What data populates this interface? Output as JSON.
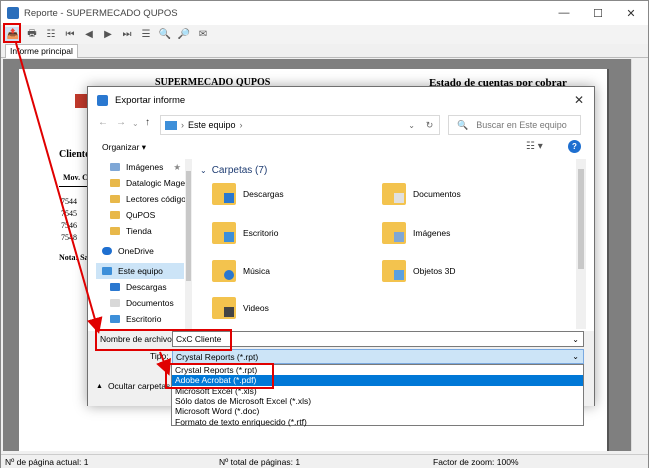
{
  "window": {
    "title": "Reporte - SUPERMECADO QUPOS",
    "tab": "Informe principal"
  },
  "report": {
    "company": "SUPERMECADO QUPOS",
    "heading": "Estado de cuentas por cobrar",
    "client_label": "Cliente",
    "mov_label": "Mov. C",
    "rows": [
      "7544",
      "7545",
      "7546",
      "7548"
    ],
    "note": "Nota: Sal"
  },
  "status": {
    "current_page": "Nº de página actual: 1",
    "total_pages": "Nº total de páginas: 1",
    "zoom": "Factor de zoom: 100%"
  },
  "dialog": {
    "title": "Exportar informe",
    "path": "Este equipo",
    "search_placeholder": "Buscar en Este equipo",
    "organize": "Organizar",
    "nav_items": [
      "Imágenes",
      "Datalogic Magel",
      "Lectores código",
      "QuPOS",
      "Tienda",
      "OneDrive",
      "Este equipo",
      "Descargas",
      "Documentos",
      "Escritorio"
    ],
    "section": "Carpetas (7)",
    "folders": [
      "Descargas",
      "Documentos",
      "Escritorio",
      "Imágenes",
      "Música",
      "Objetos 3D",
      "Videos"
    ],
    "filename_label": "Nombre de archivo:",
    "filename_value": "CxC Cliente",
    "type_label": "Tipo:",
    "type_value": "Crystal Reports (*.rpt)",
    "hide_folders": "Ocultar carpetas"
  },
  "type_options": [
    "Crystal Reports (*.rpt)",
    "Adobe Acrobat (*.pdf)",
    "Microsoft Excel (*.xls)",
    "Sólo datos de Microsoft Excel (*.xls)",
    "Microsoft Word (*.doc)",
    "Formato de texto enriquecido (*.rtf)"
  ],
  "selected_option": "Adobe Acrobat (*.pdf)"
}
